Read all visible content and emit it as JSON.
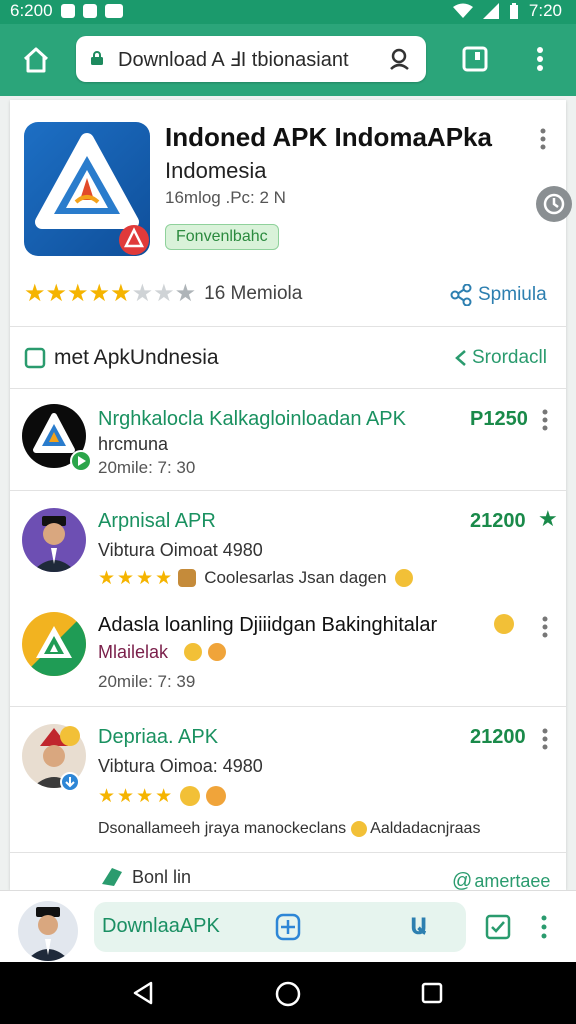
{
  "status_bar": {
    "time_left": "6:200",
    "time_right": "7:20"
  },
  "browser": {
    "url": "Download A ℲI tbionasiant"
  },
  "app": {
    "title": "Indoned APK IndomaAPka",
    "subtitle": "Indomesia",
    "meta": "16mlog .Pc: 2 N",
    "badge": "Fonvenlbahc",
    "rating_text": "16 Memiola",
    "share_label": "Spmiula",
    "stars": 5
  },
  "section": {
    "title": "met ApkUndnesia",
    "action": "Srordacll"
  },
  "items": [
    {
      "title": "Nrghkalocla Kalkagloinloadan APK",
      "subtitle": "hrcmuna",
      "time": "20mile: 7: 30",
      "price": "P1250"
    },
    {
      "title": "Arpnisal APR",
      "subtitle": "Vibtura Oimoat 4980",
      "review": "Coolesarlas Jsan dagen",
      "price": "21200"
    },
    {
      "title": "Adasla loanling Djiiidgan Bakinghitalar",
      "subtitle": "Mlailelak",
      "time": "20mile: 7: 39"
    },
    {
      "title": "Depriaa. APK",
      "subtitle": "Vibtura Oimoa: 4980",
      "review": "Dsonallameeh jraya manockeclans",
      "review_tail": "Aaldadacnjraas",
      "price": "21200"
    }
  ],
  "footer_actions": {
    "left": "Bonl lin",
    "right": "amertaee"
  },
  "bottom_bar": {
    "label": "DownlaaAPK"
  },
  "colors": {
    "brand_green": "#2ba57a",
    "status_green": "#1b9a6c",
    "star": "#f5b400"
  }
}
